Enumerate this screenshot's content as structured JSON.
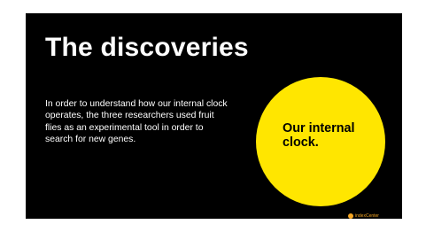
{
  "slide": {
    "title": "The discoveries",
    "body_lines": [
      "In order to understand how our internal clock",
      "operates, the three researchers used fruit",
      "flies as an experimental tool in order to",
      "search for new genes."
    ],
    "circle": {
      "lines": [
        "Our internal",
        "clock."
      ],
      "color": "#ffe600"
    },
    "background_color": "#000000"
  },
  "brand": {
    "icon": "circle-logo-icon",
    "text": "indexCenter",
    "color": "#f5a623"
  }
}
